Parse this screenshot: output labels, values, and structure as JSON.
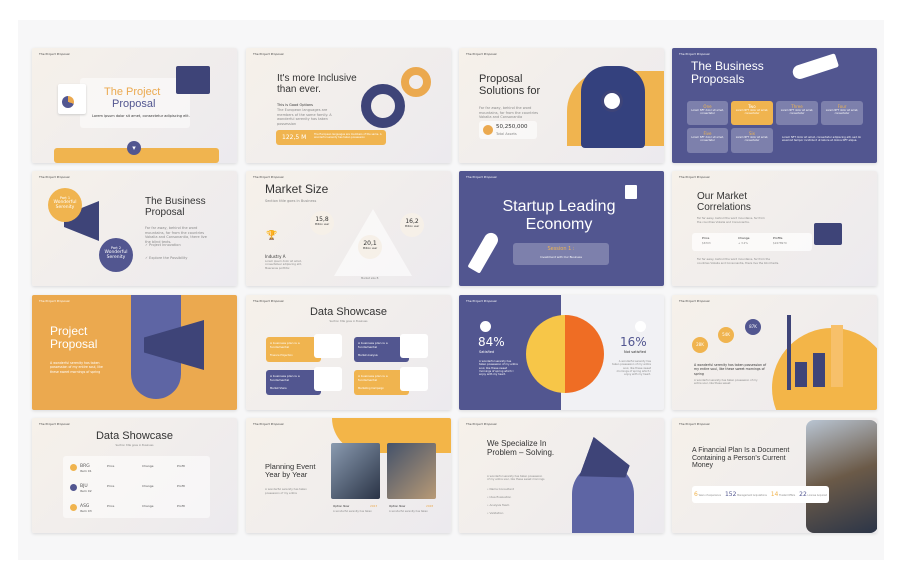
{
  "brand": "The Project Proposal",
  "colors": {
    "orange": "#eba94f",
    "navy": "#525690",
    "background": "#f6f1ea"
  },
  "slides": {
    "s1": {
      "title_a": "The Project",
      "title_b": "Proposal",
      "subtitle": "Lorem ipsum dolor sit amet, consectetur adipiscing elit.",
      "icon": "chevron-down-icon"
    },
    "s2": {
      "title": "It's more Inclusive than ever.",
      "heading": "This is Good Options",
      "body": "The European languages are members of the same family. A wonderful serenity has taken possession",
      "stat": "122,5 M",
      "stat_text": "The European languages are members of the same. A wonderful serenity has taken possession"
    },
    "s3": {
      "title": "Proposal Solutions for",
      "body": "Far far away, behind the word mountains, far from the countries Vokalia and Consonantia",
      "stat": "50,250,000",
      "stat_label": "Total Assets"
    },
    "s4": {
      "title": "The Business Proposals",
      "boxes": [
        {
          "label": "One",
          "text": "Lorem NFT dolor sit amet, consectetur"
        },
        {
          "label": "Two",
          "text": "Lorem NFT dolor sit amet, consectetur"
        },
        {
          "label": "Three",
          "text": "Lorem NFT dolor sit amet, consectetur"
        },
        {
          "label": "Four",
          "text": "Lorem NFT dolor sit amet, consectetur"
        },
        {
          "label": "Five",
          "text": "Lorem NFT dolor sit amet, consectetur"
        },
        {
          "label": "Six",
          "text": "Lorem NFT dolor sit amet, consectetur"
        }
      ],
      "body": "Lorem NFT dolor sit amet, consectetur adipiscing elit, sed do eiusmod tempor incididunt ut labore et dolore NFT aliqua."
    },
    "s5": {
      "title": "The Business Proposal",
      "circle1_top": "Part 1",
      "circle1": "Wonderful Serenity",
      "circle2_top": "Part 2",
      "circle2": "Wonderful Serenity",
      "body": "Far far away, behind the word mountains, far from the countries Vokalia and Consonantia, there live the blind texts.",
      "checks": [
        "Project Innovation",
        "Explore the Possibility"
      ]
    },
    "s6": {
      "title": "Market Size",
      "subtitle": "Section title goes in Business",
      "values": [
        {
          "v": "15,8",
          "l": "Million user"
        },
        {
          "v": "20,1",
          "l": "Million user"
        },
        {
          "v": "16,2",
          "l": "Million user"
        }
      ],
      "industry": "Industry A",
      "industry_text": "Lorem ipsum dolor sit amet, consectetuer adipiscing elit, Maecenas porttitor.",
      "tri_label": "Market size B"
    },
    "s7": {
      "title": "Startup Leading Economy",
      "session": "Session 1 :",
      "session_sub": "Investment with Our Business"
    },
    "s8": {
      "title": "Our Market Correlations",
      "body": "Far far away, behind the word mountains, far from the countries Vokalia and Consonantia.",
      "cols": [
        {
          "h": "Price",
          "v": "$6703"
        },
        {
          "h": "Change",
          "v": "+ 3.2%"
        },
        {
          "h": "Profits",
          "v": "$2478970"
        }
      ],
      "body2": "Far far away, behind the word mountains, far from the countries Vokalia and Consonantia, there live the blind texts."
    },
    "s9": {
      "title": "Project Proposal",
      "body": "A wonderful serenity has taken possession of my entire soul, like these sweet mornings of spring"
    },
    "s10": {
      "title": "Data Showcase",
      "subtitle": "Section title goes in Business",
      "cards": [
        {
          "t": "A business plan is a fundamental",
          "s": "Finance Projection"
        },
        {
          "t": "A business plan is a fundamental",
          "s": "Market Analysis"
        },
        {
          "t": "A business plan is a fundamental",
          "s": "Market Share"
        },
        {
          "t": "A business plan is a fundamental",
          "s": "Marketing Campaign"
        }
      ]
    },
    "s11": {
      "left_value": "84%",
      "left_label": "Satisfied",
      "left_text": "A wonderful serenity has taken possession of my entire soul, like these sweet mornings of spring which I enjoy with my heart.",
      "right_value": "16%",
      "right_label": "Not satisfied",
      "right_text": "A wonderful serenity has taken possession of my entire soul, like these sweet mornings of spring which I enjoy with my heart."
    },
    "s12": {
      "bubbles": [
        "28K",
        "54K",
        "87K"
      ],
      "title": "A wonderful serenity has taken possession of my entire soul, like these sweet mornings of spring",
      "body": "A wonderful serenity has taken possession of my entire soul, like these sweet"
    },
    "s13": {
      "title": "Data Showcase",
      "subtitle": "Section title goes in Business",
      "rows": [
        {
          "code": "BRG",
          "sub": "Item 01",
          "price": "Price",
          "change": "Change",
          "profit": "Profit"
        },
        {
          "code": "BJU",
          "sub": "Item 02",
          "price": "Price",
          "change": "Change",
          "profit": "Profit"
        },
        {
          "code": "ASG",
          "sub": "Item 03",
          "price": "Price",
          "change": "Change",
          "profit": "Profit"
        }
      ]
    },
    "s14": {
      "title": "Planning Event Year by Year",
      "body": "A wonderful serenity has taken possession of my entire",
      "options": [
        {
          "t": "Option Now",
          "y": "2023",
          "d": "A wonderful serenity has taken"
        },
        {
          "t": "Option Now",
          "y": "2028",
          "d": "A wonderful serenity has taken"
        }
      ]
    },
    "s15": {
      "title": "We Specialize In Problem – Solving.",
      "body": "A wonderful serenity has taken possession of my entire soul, like these sweet mornings",
      "list": [
        "Name Consultant",
        "Idea Evaluation",
        "Analysis Team",
        "Validation"
      ]
    },
    "s16": {
      "title": "A Financial Plan Is a Document Containing a Person's Current Money",
      "stats": [
        {
          "v": "6",
          "l": "Years of experience"
        },
        {
          "v": "152",
          "l": "Management Acquisitions"
        },
        {
          "v": "14",
          "l": "Trusted Offers"
        },
        {
          "v": "22",
          "l": "License Acquired"
        }
      ]
    }
  }
}
